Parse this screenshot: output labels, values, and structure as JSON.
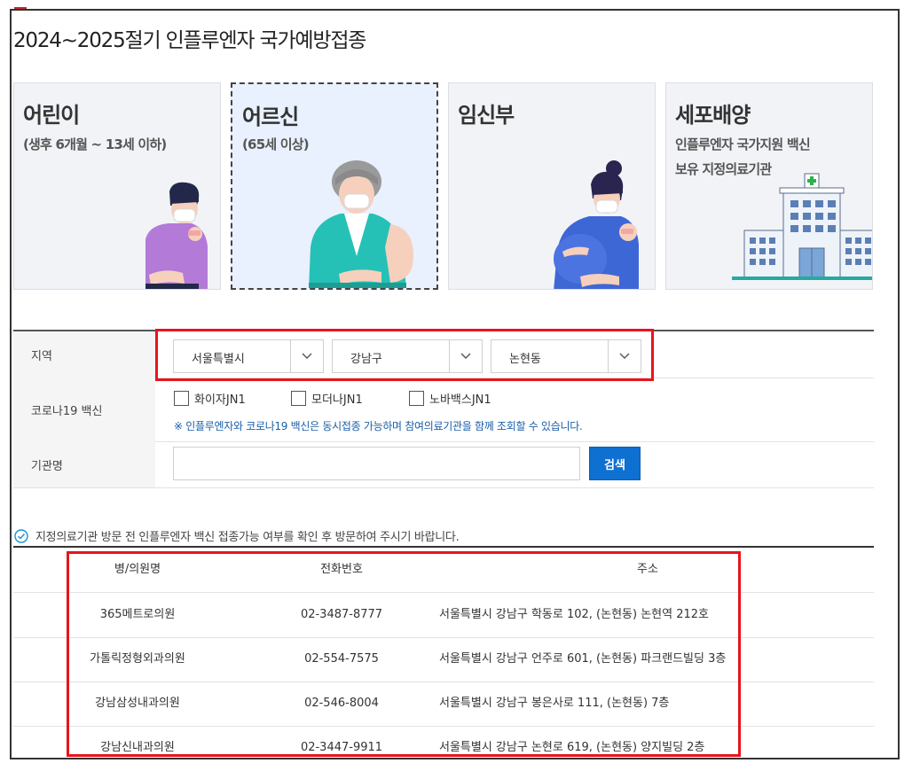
{
  "page_title": "2024~2025절기 인플루엔자 국가예방접종",
  "cards": [
    {
      "title": "어린이",
      "sub": [
        "(생후 6개월 ~ 13세 이하)"
      ]
    },
    {
      "title": "어르신",
      "sub": [
        "(65세 이상)"
      ]
    },
    {
      "title": "임신부",
      "sub": []
    },
    {
      "title": "세포배양",
      "sub": [
        "인플루엔자 국가지원 백신",
        "보유 지정의료기관"
      ]
    }
  ],
  "form": {
    "region_label": "지역",
    "region_selects": [
      "서울특별시",
      "강남구",
      "논현동"
    ],
    "covid_label": "코로나19 백신",
    "covid_options": [
      "화이자JN1",
      "모더나JN1",
      "노바백스JN1"
    ],
    "covid_notice": "※ 인플루엔자와 코로나19 백신은 동시접종 가능하며 참여의료기관을 함께 조회할 수 있습니다.",
    "institution_label": "기관명",
    "institution_value": "",
    "search_label": "검색"
  },
  "info_notice": "지정의료기관 방문 전 인플루엔자 백신 접종가능 여부를 확인 후 방문하여 주시기 바랍니다.",
  "table": {
    "headers": [
      "병/의원명",
      "전화번호",
      "주소"
    ],
    "rows": [
      {
        "name": "365메트로의원",
        "phone": "02-3487-8777",
        "address": "서울특별시 강남구 학동로 102, (논현동) 논현역 212호"
      },
      {
        "name": "가톨릭정형외과의원",
        "phone": "02-554-7575",
        "address": "서울특별시 강남구 언주로 601, (논현동) 파크랜드빌딩 3층"
      },
      {
        "name": "강남삼성내과의원",
        "phone": "02-546-8004",
        "address": "서울특별시 강남구 봉은사로 111, (논현동) 7층"
      },
      {
        "name": "강남신내과의원",
        "phone": "02-3447-9911",
        "address": "서울특별시 강남구 논현로 619, (논현동) 양지빌딩 2층"
      }
    ]
  },
  "colors": {
    "accent_blue": "#0e70d1",
    "highlight_red": "#e8141b",
    "notice_blue": "#1a5fa8"
  }
}
